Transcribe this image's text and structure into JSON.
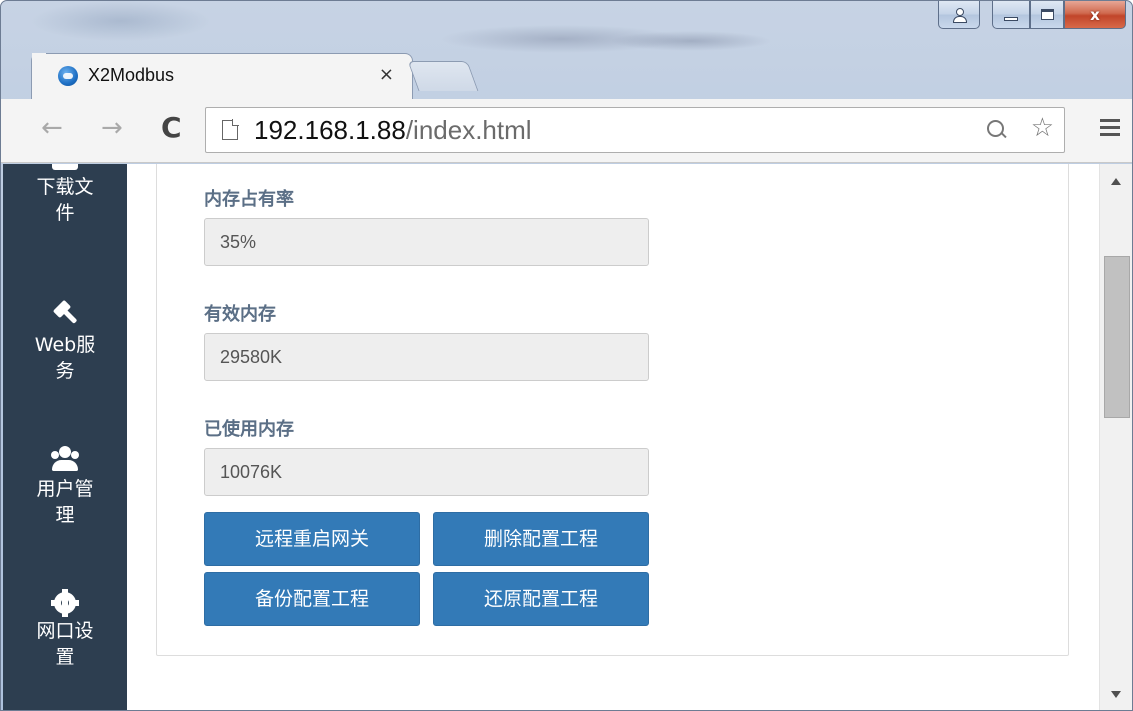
{
  "browser": {
    "tab": {
      "title": "X2Modbus",
      "close_glyph": "×"
    },
    "toolbar": {
      "back_glyph": "←",
      "forward_glyph": "→",
      "reload_glyph": "C",
      "url_host": "192.168.1.88",
      "url_path": "/index.html",
      "star_glyph": "☆"
    },
    "window": {
      "close_glyph": "x"
    }
  },
  "sidebar": {
    "items": [
      {
        "label": "下载文件",
        "icon": "download-icon"
      },
      {
        "label": "Web服务",
        "icon": "gavel-icon"
      },
      {
        "label": "用户管理",
        "icon": "users-icon"
      },
      {
        "label": "网口设置",
        "icon": "gear-icon"
      }
    ]
  },
  "main": {
    "fields": [
      {
        "label": "内存占有率",
        "value": "35%"
      },
      {
        "label": "有效内存",
        "value": "29580K"
      },
      {
        "label": "已使用内存",
        "value": "10076K"
      }
    ],
    "buttons": {
      "reboot": "远程重启网关",
      "delete_config": "删除配置工程",
      "backup_config": "备份配置工程",
      "restore_config": "还原配置工程"
    }
  },
  "colors": {
    "sidebar_bg": "#2d3e50",
    "button_primary": "#337ab7",
    "label_text": "#5b6f86"
  }
}
